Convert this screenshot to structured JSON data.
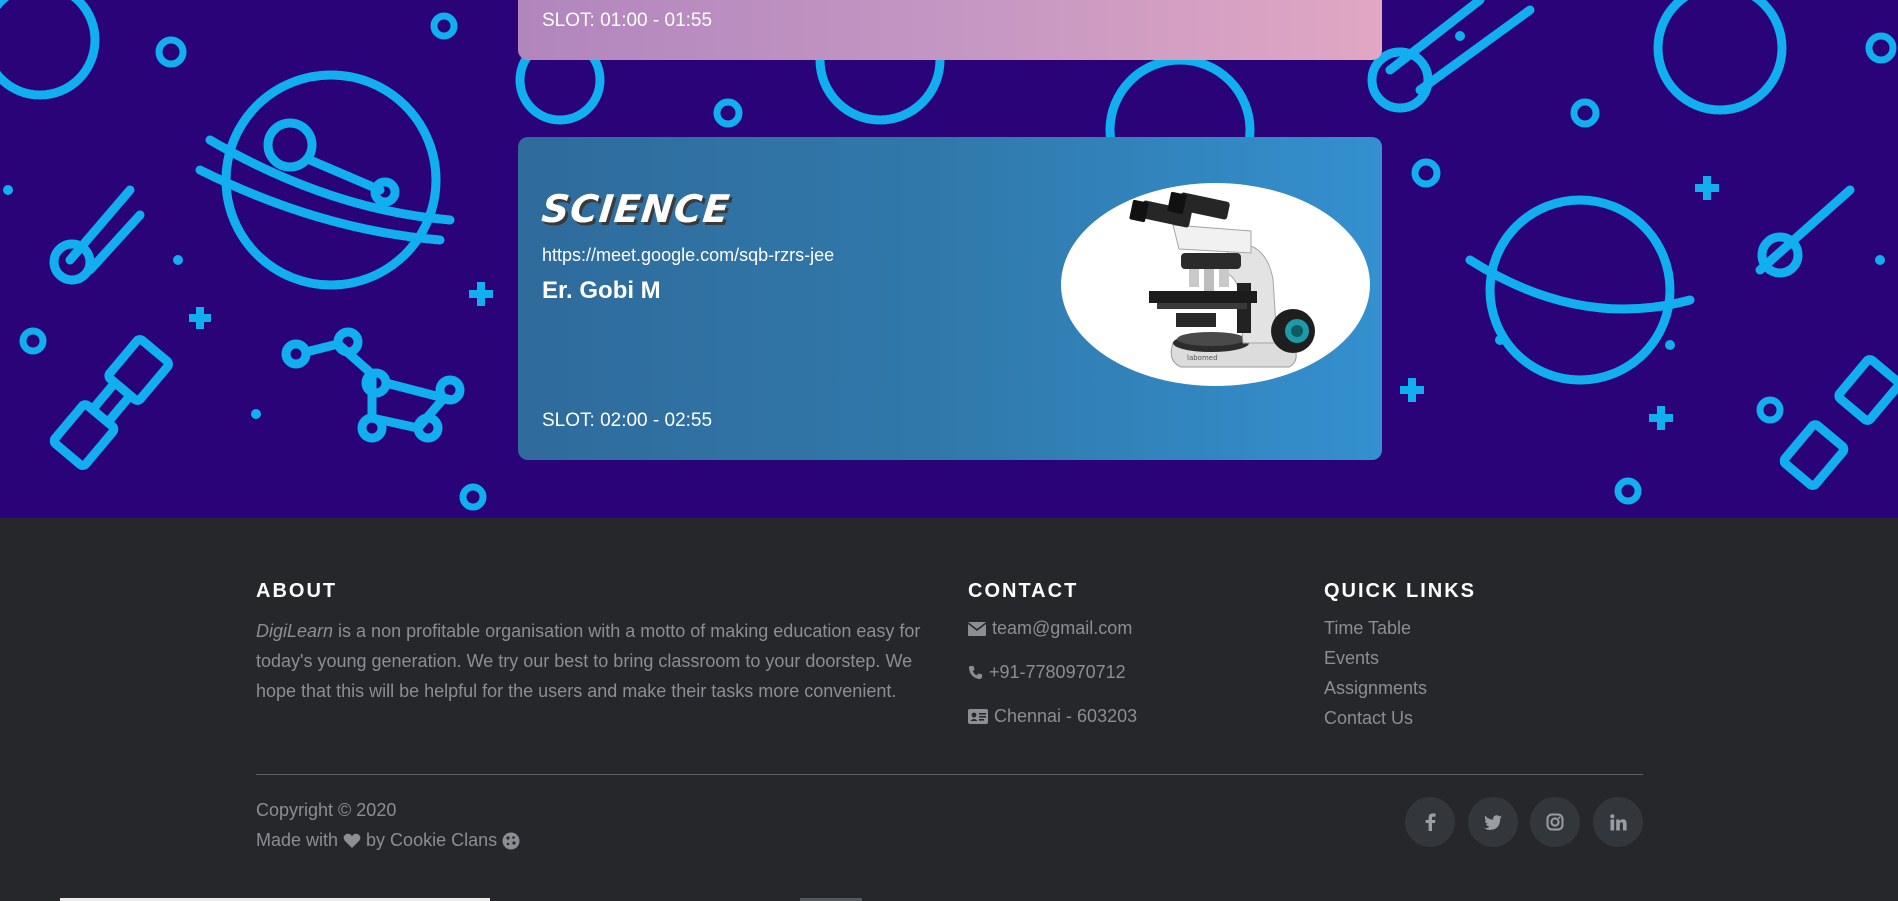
{
  "cards": {
    "previous": {
      "slot": "SLOT: 01:00 - 01:55"
    },
    "science": {
      "subject": "SCIENCE",
      "link": "https://meet.google.com/sqb-rzrs-jee",
      "teacher": "Er. Gobi M",
      "slot": "SLOT: 02:00 - 02:55",
      "image_icon": "microscope-image"
    }
  },
  "footer": {
    "about": {
      "heading": "ABOUT",
      "brand": "DigiLearn",
      "text": " is a non profitable organisation with a motto of making education easy for today's young generation. We try our best to bring classroom to your doorstep. We hope that this will be helpful for the users and make their tasks more convenient."
    },
    "contact": {
      "heading": "CONTACT",
      "email": "team@gmail.com",
      "phone": "+91-7780970712",
      "address": "Chennai - 603203"
    },
    "quick_links": {
      "heading": "QUICK LINKS",
      "items": [
        "Time Table",
        "Events",
        "Assignments",
        "Contact Us"
      ]
    },
    "copyright": "Copyright © 2020",
    "made_with_prefix": "Made with",
    "made_with_suffix": "by Cookie Clans",
    "social": [
      "facebook-icon",
      "twitter-icon",
      "instagram-icon",
      "linkedin-icon"
    ]
  },
  "colors": {
    "space_background": "#2a0378",
    "space_icons": "#11aef0",
    "card_previous": "#c496c2",
    "card_science": "#3079ab",
    "footer_background": "#25272a"
  }
}
